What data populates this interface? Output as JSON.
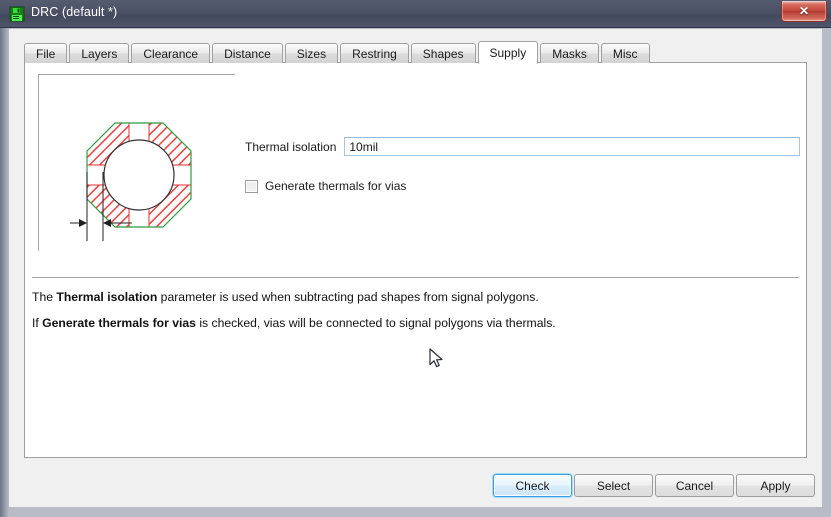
{
  "window": {
    "title": "DRC (default *)",
    "icon": "floppy-disk-icon",
    "close_label": "✕",
    "titlebar_color": "#4b5165",
    "close_color": "#c2453a"
  },
  "tabs": [
    {
      "label": "File",
      "active": false
    },
    {
      "label": "Layers",
      "active": false
    },
    {
      "label": "Clearance",
      "active": false
    },
    {
      "label": "Distance",
      "active": false
    },
    {
      "label": "Sizes",
      "active": false
    },
    {
      "label": "Restring",
      "active": false
    },
    {
      "label": "Shapes",
      "active": false
    },
    {
      "label": "Supply",
      "active": true
    },
    {
      "label": "Masks",
      "active": false
    },
    {
      "label": "Misc",
      "active": false
    }
  ],
  "illustration": {
    "name": "thermal-pad-diagram",
    "outline_color": "#2e9b3f",
    "hatch_color": "#f04040",
    "circle_color": "#303030",
    "dimension_color": "#202020"
  },
  "form": {
    "thermal_isolation": {
      "label": "Thermal isolation",
      "value": "10mil",
      "placeholder": ""
    },
    "generate_thermals": {
      "label": "Generate thermals for vias",
      "checked": false
    }
  },
  "description": {
    "line1_pre": "The ",
    "line1_bold": "Thermal isolation",
    "line1_post": " parameter is used when subtracting pad shapes from signal polygons.",
    "line2_pre": "If ",
    "line2_bold": "Generate thermals for vias",
    "line2_post": " is checked, vias will be connected to signal polygons via thermals."
  },
  "buttons": [
    {
      "label": "Check",
      "focused": true
    },
    {
      "label": "Select",
      "focused": false
    },
    {
      "label": "Cancel",
      "focused": false
    },
    {
      "label": "Apply",
      "focused": false
    }
  ]
}
